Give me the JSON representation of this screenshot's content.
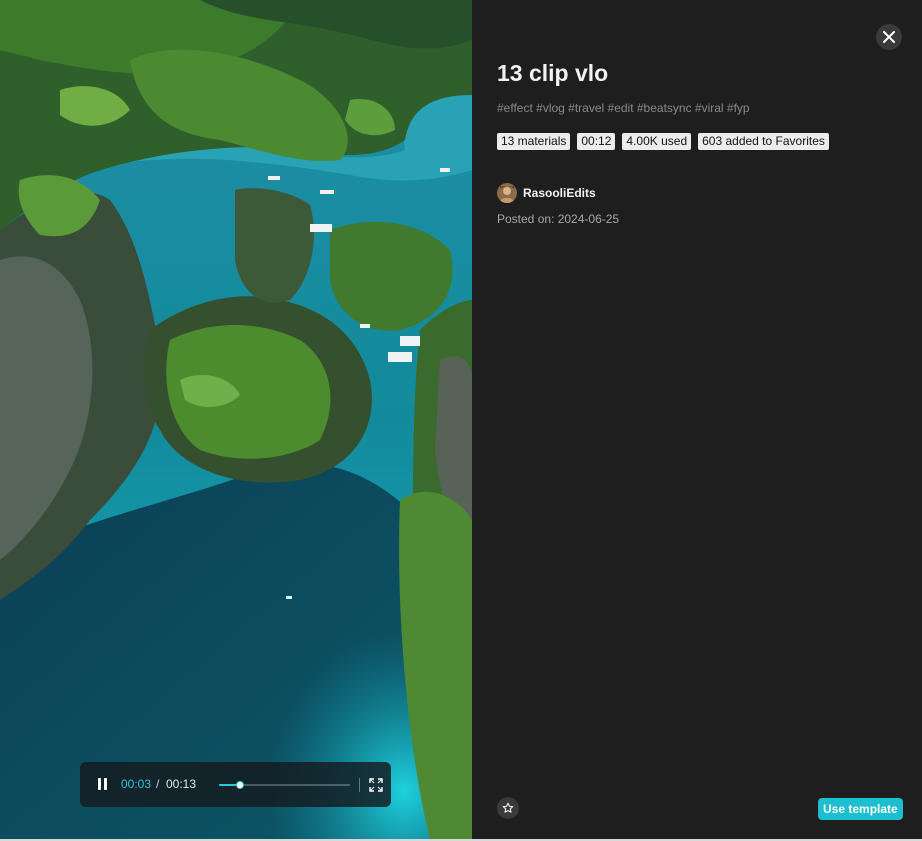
{
  "video": {
    "current_time": "00:03",
    "separator": "/",
    "total_time": "00:13",
    "progress_fraction": 0.16,
    "state": "playing",
    "icons": {
      "pause": "pause-icon",
      "fullscreen": "fullscreen-icon"
    }
  },
  "template": {
    "title": "13 clip vlo",
    "tags": "#effect #vlog #travel #edit #beatsync #viral #fyp",
    "badges": [
      "13 materials",
      "00:12",
      "4.00K used",
      "603 added to Favorites"
    ],
    "author": "RasooliEdits",
    "posted": "Posted on: 2024-06-25"
  },
  "actions": {
    "close_icon": "close-icon",
    "favorite_icon": "star-icon",
    "use_template_label": "Use template"
  },
  "colors": {
    "accent": "#1bbfd0",
    "progress": "#2fc6d6",
    "panel_bg": "#1e1e1e"
  }
}
